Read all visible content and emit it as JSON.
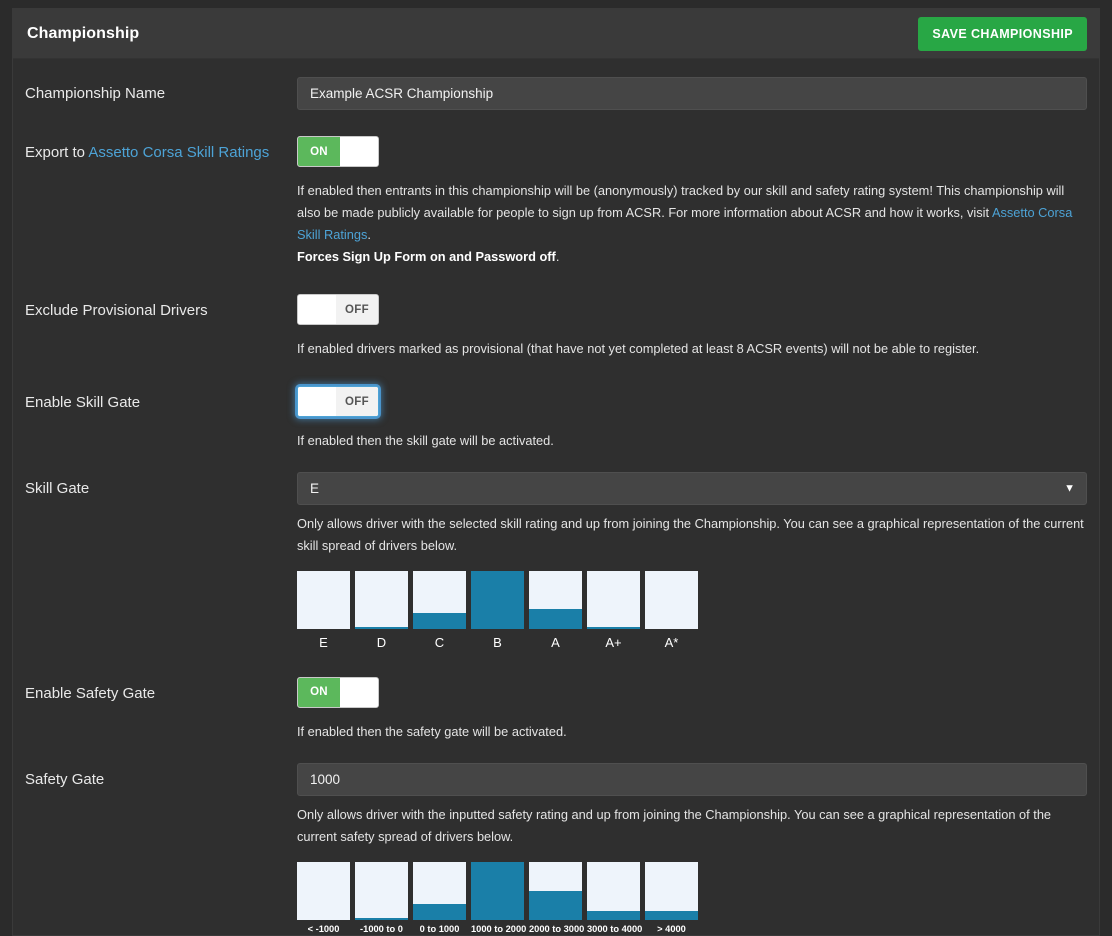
{
  "header": {
    "title": "Championship",
    "save_label": "SAVE CHAMPIONSHIP",
    "accent_green": "#28a745"
  },
  "form": {
    "championship_name": {
      "label": "Championship Name",
      "value": "Example ACSR Championship",
      "placeholder": "Championship Name"
    },
    "export_to_acsr": {
      "label_prefix": "Export to ",
      "label_link": "Assetto Corsa Skill Ratings",
      "toggle_state": "ON",
      "help_part1": "If enabled then entrants in this championship will be (anonymously) tracked by our skill and safety rating system! This championship will also be made publicly available for people to sign up from ACSR. For more information about ACSR and how it works, visit ",
      "help_link": "Assetto Corsa Skill Ratings",
      "help_part2": ".",
      "help_bold": "Forces Sign Up Form on and Password off",
      "help_bold_suffix": "."
    },
    "exclude_provisional": {
      "label": "Exclude Provisional Drivers",
      "toggle_state": "OFF",
      "help": "If enabled drivers marked as provisional (that have not yet completed at least 8 ACSR events) will not be able to register."
    },
    "enable_skill_gate": {
      "label": "Enable Skill Gate",
      "toggle_state": "OFF",
      "help": "If enabled then the skill gate will be activated."
    },
    "skill_gate": {
      "label": "Skill Gate",
      "value": "E",
      "options": [
        "E",
        "D",
        "C",
        "B",
        "A",
        "A+",
        "A*"
      ],
      "help": "Only allows driver with the selected skill rating and up from joining the Championship. You can see a graphical representation of the current skill spread of drivers below."
    },
    "enable_safety_gate": {
      "label": "Enable Safety Gate",
      "toggle_state": "ON",
      "help": "If enabled then the safety gate will be activated."
    },
    "safety_gate": {
      "label": "Safety Gate",
      "value": "1000",
      "placeholder": "Safety Gate",
      "help": "Only allows driver with the inputted safety rating and up from joining the Championship. You can see a graphical representation of the current safety spread of drivers below."
    }
  },
  "chart_data": [
    {
      "type": "bar",
      "name": "skill-spread",
      "title": "",
      "xlabel": "",
      "ylabel": "",
      "categories": [
        "E",
        "D",
        "C",
        "B",
        "A",
        "A+",
        "A*"
      ],
      "values": [
        0,
        3,
        28,
        100,
        34,
        4,
        0
      ],
      "ylim": [
        0,
        100
      ],
      "grid": false,
      "legend": "none",
      "bar_color": "#1a7fa8",
      "track_color": "#eef4fb"
    },
    {
      "type": "bar",
      "name": "safety-spread",
      "title": "",
      "xlabel": "",
      "ylabel": "",
      "categories": [
        "< -1000",
        "-1000 to 0",
        "0 to 1000",
        "1000 to 2000",
        "2000 to 3000",
        "3000 to 4000",
        "> 4000"
      ],
      "values": [
        0,
        3,
        27,
        100,
        50,
        14,
        14
      ],
      "ylim": [
        0,
        100
      ],
      "grid": false,
      "legend": "none",
      "bar_color": "#1a7fa8",
      "track_color": "#eef4fb"
    }
  ]
}
